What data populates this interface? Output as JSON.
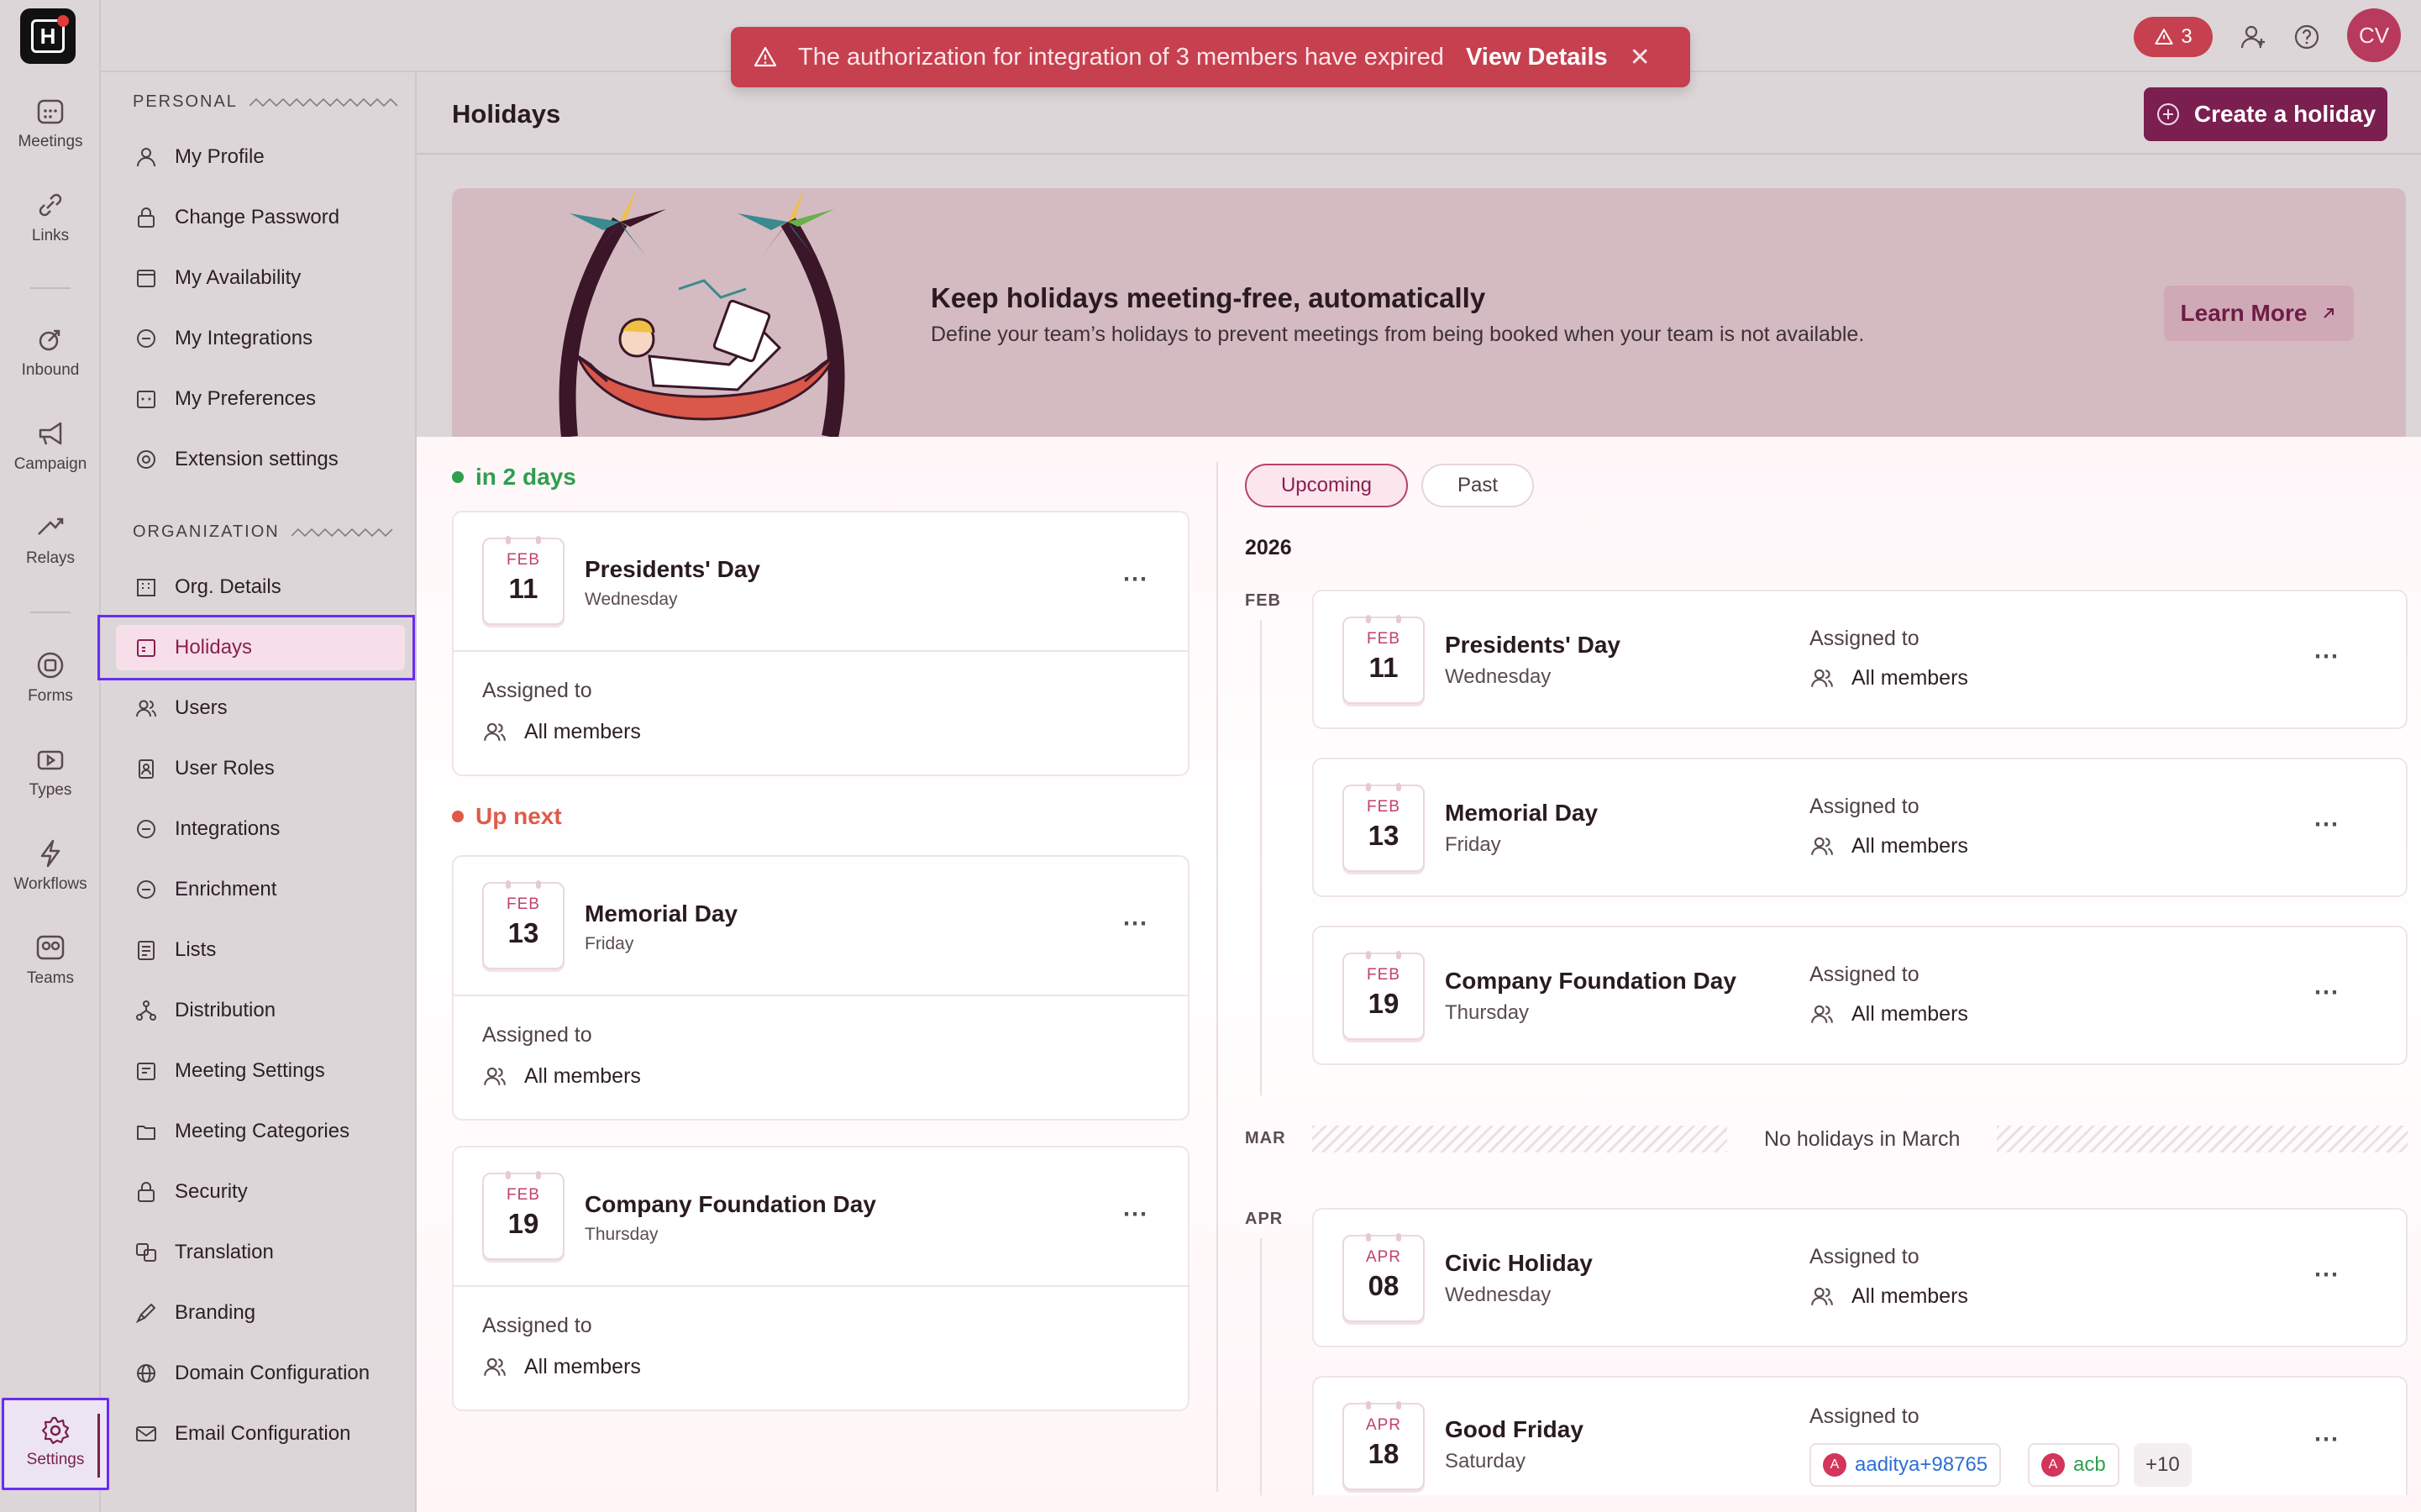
{
  "toast": {
    "message": "The authorization for integration of 3 members have expired",
    "link": "View Details"
  },
  "topbar": {
    "alert_count": "3",
    "avatar_initials": "CV"
  },
  "rail": {
    "items": [
      "Meetings",
      "Links",
      "Inbound",
      "Campaign",
      "Relays",
      "Forms",
      "Types",
      "Workflows",
      "Teams"
    ],
    "settings": "Settings"
  },
  "sidebar": {
    "personal_heading": "PERSONAL",
    "personal": [
      "My Profile",
      "Change Password",
      "My Availability",
      "My Integrations",
      "My Preferences",
      "Extension settings"
    ],
    "org_heading": "ORGANIZATION",
    "org": [
      "Org. Details",
      "Holidays",
      "Users",
      "User Roles",
      "Integrations",
      "Enrichment",
      "Lists",
      "Distribution",
      "Meeting Settings",
      "Meeting Categories",
      "Security",
      "Translation",
      "Branding",
      "Domain Configuration",
      "Email Configuration"
    ]
  },
  "header": {
    "title": "Holidays",
    "create_label": "Create a holiday"
  },
  "hero": {
    "title": "Keep holidays meeting-free, automatically",
    "subtitle": "Define your team’s holidays to prevent meetings from being booked when your team is not available.",
    "learn_more": "Learn More"
  },
  "left": {
    "group1": "in 2 days",
    "group2": "Up next",
    "assigned_label": "Assigned to",
    "cards": [
      {
        "month": "FEB",
        "day": "11",
        "name": "Presidents' Day",
        "weekday": "Wednesday",
        "assigned": "All members"
      },
      {
        "month": "FEB",
        "day": "13",
        "name": "Memorial Day",
        "weekday": "Friday",
        "assigned": "All members"
      },
      {
        "month": "FEB",
        "day": "19",
        "name": "Company Foundation Day",
        "weekday": "Thursday",
        "assigned": "All members"
      }
    ]
  },
  "right": {
    "tabs": [
      "Upcoming",
      "Past"
    ],
    "year": "2026",
    "months": [
      "FEB",
      "MAR",
      "APR"
    ],
    "no_holidays": "No holidays in March",
    "assigned_label": "Assigned to",
    "cards": [
      {
        "month": "FEB",
        "day": "11",
        "name": "Presidents' Day",
        "weekday": "Wednesday",
        "assigned": "All members"
      },
      {
        "month": "FEB",
        "day": "13",
        "name": "Memorial Day",
        "weekday": "Friday",
        "assigned": "All members"
      },
      {
        "month": "FEB",
        "day": "19",
        "name": "Company Foundation Day",
        "weekday": "Thursday",
        "assigned": "All members"
      },
      {
        "month": "APR",
        "day": "08",
        "name": "Civic Holiday",
        "weekday": "Wednesday",
        "assigned": "All members"
      },
      {
        "month": "APR",
        "day": "18",
        "name": "Good Friday",
        "weekday": "Saturday",
        "assigned": ""
      }
    ],
    "chips": [
      {
        "initial": "A",
        "label": "aaditya+98765"
      },
      {
        "initial": "A",
        "label": "acb"
      }
    ],
    "more_count": "+10"
  },
  "colors": {
    "brand": "#7a1f4f",
    "accent_pink": "#c2406b",
    "toast": "#c6404f",
    "green": "#2e9e4f",
    "red": "#e05a48"
  }
}
